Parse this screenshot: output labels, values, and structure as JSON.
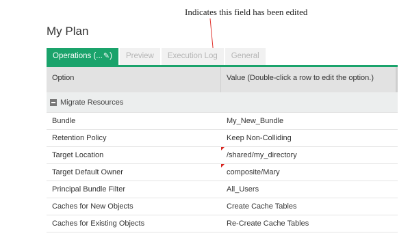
{
  "callout": {
    "text": "Indicates this field has been edited"
  },
  "page": {
    "title": "My Plan"
  },
  "tabs": [
    {
      "label": "Operations (...",
      "active": true
    },
    {
      "label": "Preview",
      "active": false
    },
    {
      "label": "Execution Log",
      "active": false
    },
    {
      "label": "General",
      "active": false
    }
  ],
  "table": {
    "headers": {
      "option": "Option",
      "value": "Value (Double-click a row to edit the option.)"
    },
    "group": {
      "label": "Migrate Resources"
    },
    "rows": [
      {
        "option": "Bundle",
        "value": "My_New_Bundle",
        "edited": false
      },
      {
        "option": "Retention Policy",
        "value": "Keep Non-Colliding",
        "edited": false
      },
      {
        "option": "Target Location",
        "value": "/shared/my_directory",
        "edited": true
      },
      {
        "option": "Target Default Owner",
        "value": "composite/Mary",
        "edited": true
      },
      {
        "option": "Principal Bundle Filter",
        "value": "All_Users",
        "edited": false
      },
      {
        "option": "Caches for New Objects",
        "value": "Create Cache Tables",
        "edited": false
      },
      {
        "option": "Caches for Existing Objects",
        "value": "Re-Create Cache Tables",
        "edited": false
      }
    ]
  },
  "colors": {
    "accent": "#1aa36b",
    "edited_marker": "#d8231e"
  },
  "icons": {
    "active_tab": "pencil-icon",
    "group_toggle": "collapse-minus-icon"
  }
}
